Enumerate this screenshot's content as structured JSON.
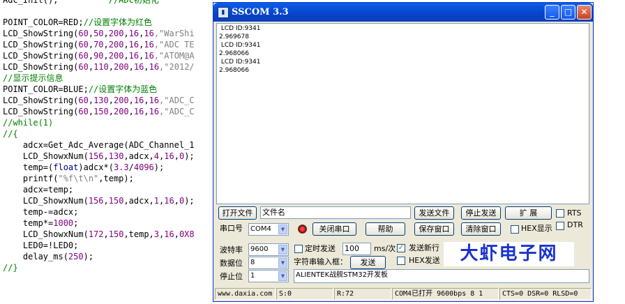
{
  "editor": {
    "lines": [
      {
        "segs": [
          {
            "t": "Adc_Init();          ",
            "c": ""
          },
          {
            "t": "//ADC初始化",
            "c": "cm"
          }
        ]
      },
      {
        "segs": [
          {
            "t": "",
            "c": ""
          }
        ]
      },
      {
        "segs": [
          {
            "t": "POINT_COLOR=RED;",
            "c": ""
          },
          {
            "t": "//设置字体为红色",
            "c": "cm"
          }
        ]
      },
      {
        "segs": [
          {
            "t": "LCD_ShowString(",
            "c": ""
          },
          {
            "t": "60",
            "c": "num"
          },
          {
            "t": ",",
            "c": ""
          },
          {
            "t": "50",
            "c": "num"
          },
          {
            "t": ",",
            "c": ""
          },
          {
            "t": "200",
            "c": "num"
          },
          {
            "t": ",",
            "c": ""
          },
          {
            "t": "16",
            "c": "num"
          },
          {
            "t": ",",
            "c": ""
          },
          {
            "t": "16",
            "c": "num"
          },
          {
            "t": ",\"WarShi",
            "c": "str"
          }
        ]
      },
      {
        "segs": [
          {
            "t": "LCD_ShowString(",
            "c": ""
          },
          {
            "t": "60",
            "c": "num"
          },
          {
            "t": ",",
            "c": ""
          },
          {
            "t": "70",
            "c": "num"
          },
          {
            "t": ",",
            "c": ""
          },
          {
            "t": "200",
            "c": "num"
          },
          {
            "t": ",",
            "c": ""
          },
          {
            "t": "16",
            "c": "num"
          },
          {
            "t": ",",
            "c": ""
          },
          {
            "t": "16",
            "c": "num"
          },
          {
            "t": ",\"ADC TE",
            "c": "str"
          }
        ]
      },
      {
        "segs": [
          {
            "t": "LCD_ShowString(",
            "c": ""
          },
          {
            "t": "60",
            "c": "num"
          },
          {
            "t": ",",
            "c": ""
          },
          {
            "t": "90",
            "c": "num"
          },
          {
            "t": ",",
            "c": ""
          },
          {
            "t": "200",
            "c": "num"
          },
          {
            "t": ",",
            "c": ""
          },
          {
            "t": "16",
            "c": "num"
          },
          {
            "t": ",",
            "c": ""
          },
          {
            "t": "16",
            "c": "num"
          },
          {
            "t": ",\"ATOM@A",
            "c": "str"
          }
        ]
      },
      {
        "segs": [
          {
            "t": "LCD_ShowString(",
            "c": ""
          },
          {
            "t": "60",
            "c": "num"
          },
          {
            "t": ",",
            "c": ""
          },
          {
            "t": "110",
            "c": "num"
          },
          {
            "t": ",",
            "c": ""
          },
          {
            "t": "200",
            "c": "num"
          },
          {
            "t": ",",
            "c": ""
          },
          {
            "t": "16",
            "c": "num"
          },
          {
            "t": ",",
            "c": ""
          },
          {
            "t": "16",
            "c": "num"
          },
          {
            "t": ",\"2012/",
            "c": "str"
          }
        ]
      },
      {
        "segs": [
          {
            "t": "//显示提示信息",
            "c": "cm"
          }
        ]
      },
      {
        "segs": [
          {
            "t": "POINT_COLOR=BLUE;",
            "c": ""
          },
          {
            "t": "//设置字体为蓝色",
            "c": "cm"
          }
        ]
      },
      {
        "segs": [
          {
            "t": "LCD_ShowString(",
            "c": ""
          },
          {
            "t": "60",
            "c": "num"
          },
          {
            "t": ",",
            "c": ""
          },
          {
            "t": "130",
            "c": "num"
          },
          {
            "t": ",",
            "c": ""
          },
          {
            "t": "200",
            "c": "num"
          },
          {
            "t": ",",
            "c": ""
          },
          {
            "t": "16",
            "c": "num"
          },
          {
            "t": ",",
            "c": ""
          },
          {
            "t": "16",
            "c": "num"
          },
          {
            "t": ",\"ADC_C",
            "c": "str"
          }
        ]
      },
      {
        "segs": [
          {
            "t": "LCD_ShowString(",
            "c": ""
          },
          {
            "t": "60",
            "c": "num"
          },
          {
            "t": ",",
            "c": ""
          },
          {
            "t": "150",
            "c": "num"
          },
          {
            "t": ",",
            "c": ""
          },
          {
            "t": "200",
            "c": "num"
          },
          {
            "t": ",",
            "c": ""
          },
          {
            "t": "16",
            "c": "num"
          },
          {
            "t": ",",
            "c": ""
          },
          {
            "t": "16",
            "c": "num"
          },
          {
            "t": ",\"ADC_C",
            "c": "str"
          }
        ]
      },
      {
        "segs": [
          {
            "t": "//while(1)",
            "c": "cm"
          }
        ]
      },
      {
        "segs": [
          {
            "t": "//{",
            "c": "cm"
          }
        ]
      },
      {
        "segs": [
          {
            "t": "    adcx=Get_Adc_Average(ADC_Channel_1",
            "c": ""
          }
        ]
      },
      {
        "segs": [
          {
            "t": "    LCD_ShowxNum(",
            "c": ""
          },
          {
            "t": "156",
            "c": "num"
          },
          {
            "t": ",",
            "c": ""
          },
          {
            "t": "130",
            "c": "num"
          },
          {
            "t": ",adcx,",
            "c": ""
          },
          {
            "t": "4",
            "c": "num"
          },
          {
            "t": ",",
            "c": ""
          },
          {
            "t": "16",
            "c": "num"
          },
          {
            "t": ",",
            "c": ""
          },
          {
            "t": "0",
            "c": "num"
          },
          {
            "t": ");",
            "c": ""
          }
        ]
      },
      {
        "segs": [
          {
            "t": "    temp=(",
            "c": ""
          },
          {
            "t": "float",
            "c": "kw"
          },
          {
            "t": ")adcx*(",
            "c": ""
          },
          {
            "t": "3.3",
            "c": "num"
          },
          {
            "t": "/",
            "c": ""
          },
          {
            "t": "4096",
            "c": "num"
          },
          {
            "t": ");",
            "c": ""
          }
        ]
      },
      {
        "segs": [
          {
            "t": "    printf(",
            "c": ""
          },
          {
            "t": "\"%f\\t\\n\"",
            "c": "str"
          },
          {
            "t": ",temp);",
            "c": ""
          }
        ]
      },
      {
        "segs": [
          {
            "t": "    adcx=temp;",
            "c": ""
          }
        ]
      },
      {
        "segs": [
          {
            "t": "    LCD_ShowxNum(",
            "c": ""
          },
          {
            "t": "156",
            "c": "num"
          },
          {
            "t": ",",
            "c": ""
          },
          {
            "t": "150",
            "c": "num"
          },
          {
            "t": ",adcx,",
            "c": ""
          },
          {
            "t": "1",
            "c": "num"
          },
          {
            "t": ",",
            "c": ""
          },
          {
            "t": "16",
            "c": "num"
          },
          {
            "t": ",",
            "c": ""
          },
          {
            "t": "0",
            "c": "num"
          },
          {
            "t": ");",
            "c": ""
          }
        ]
      },
      {
        "segs": [
          {
            "t": "    temp-=adcx;",
            "c": ""
          }
        ]
      },
      {
        "segs": [
          {
            "t": "    temp*=",
            "c": ""
          },
          {
            "t": "1000",
            "c": "num"
          },
          {
            "t": ";",
            "c": ""
          }
        ]
      },
      {
        "segs": [
          {
            "t": "    LCD_ShowxNum(",
            "c": ""
          },
          {
            "t": "172",
            "c": "num"
          },
          {
            "t": ",",
            "c": ""
          },
          {
            "t": "150",
            "c": "num"
          },
          {
            "t": ",temp,",
            "c": ""
          },
          {
            "t": "3",
            "c": "num"
          },
          {
            "t": ",",
            "c": ""
          },
          {
            "t": "16",
            "c": "num"
          },
          {
            "t": ",",
            "c": ""
          },
          {
            "t": "0X8",
            "c": "num"
          }
        ]
      },
      {
        "segs": [
          {
            "t": "    LED0=!LED0;",
            "c": ""
          }
        ]
      },
      {
        "segs": [
          {
            "t": "    delay_ms(",
            "c": ""
          },
          {
            "t": "250",
            "c": "num"
          },
          {
            "t": ");",
            "c": ""
          }
        ]
      },
      {
        "segs": [
          {
            "t": "//}",
            "c": "cm"
          }
        ]
      }
    ]
  },
  "window": {
    "title": "SSCOM 3.3",
    "minimize": "_",
    "maximize": "□",
    "close": "✕"
  },
  "output": {
    "lines": [
      " LCD ID:9341",
      "2.969678",
      " LCD ID:9341",
      "2.968066",
      " LCD ID:9341",
      "2.968066"
    ]
  },
  "controls": {
    "open_file": "打开文件",
    "filename": "文件名",
    "send_file": "发送文件",
    "stop_send": "停止发送",
    "expand": "扩 展",
    "rts": "RTS",
    "dtr": "DTR",
    "port_label": "串口号",
    "port_value": "COM4",
    "close_port": "关闭串口",
    "help": "帮助",
    "save_window": "保存窗口",
    "clear_window": "清除窗口",
    "hex_display": "HEX显示",
    "baud_label": "波特率",
    "baud_value": "9600",
    "databits_label": "数据位",
    "databits_value": "8",
    "stopbits_label": "停止位",
    "stopbits_value": "1",
    "timed_send": "定时发送",
    "interval_value": "100",
    "interval_unit": "ms/次",
    "send_newline": "发送新行",
    "send_newline_checked": "✓",
    "string_input_label": "字符串输入框：",
    "send": "发送",
    "hex_send": "HEX发送",
    "input_value": "ALIENTEK战舰STM32开发板",
    "brand": "大虾电子网"
  },
  "status": {
    "site": "www.daxia.com",
    "s": "S:0",
    "r": "R:72",
    "port_state": "COM4已打开  9600bps  8 1",
    "lines": "CTS=0 DSR=0 RLSD=0"
  },
  "colors": {
    "title_blue": "#0743c9",
    "brand_blue": "#1a33cc",
    "comment_green": "#008000",
    "number_purple": "#800080"
  }
}
